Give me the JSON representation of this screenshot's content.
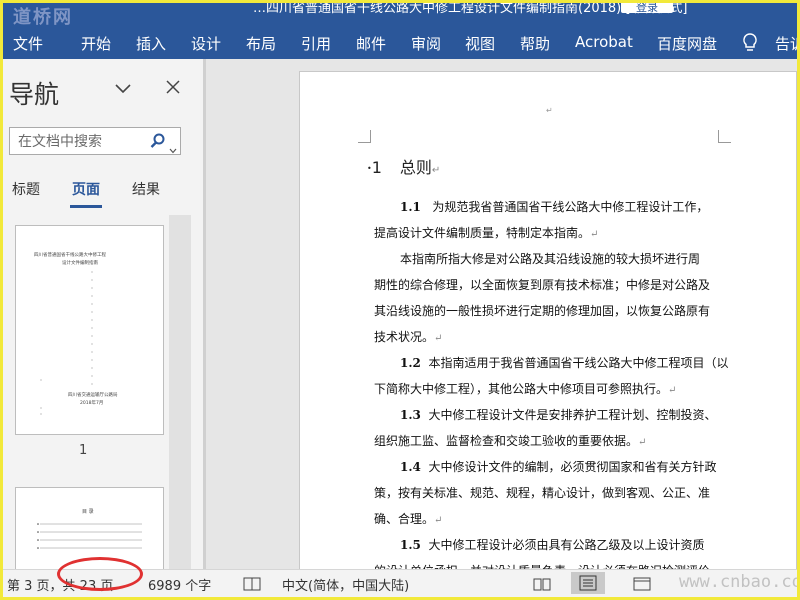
{
  "watermark": "道桥网",
  "title_bar": {
    "title": "…四川省普通国省干线公路大中修工程设计文件编制指南(2018) [兼容模式]",
    "login_label": "登录"
  },
  "ribbon": {
    "tabs": [
      "文件",
      "开始",
      "插入",
      "设计",
      "布局",
      "引用",
      "邮件",
      "审阅",
      "视图",
      "帮助",
      "Acrobat",
      "百度网盘",
      "告诉"
    ],
    "icons": [
      "lightbulb-icon"
    ]
  },
  "navigation": {
    "title": "导航",
    "search_placeholder": "在文档中搜索",
    "tabs": [
      "标题",
      "页面",
      "结果"
    ],
    "active_tab": "页面",
    "thumbnails": [
      {
        "page_number": "1",
        "lines": [
          "四川省普通国省干线公路大中修工程",
          "设计文件编制指南"
        ],
        "footer": [
          "四川省交通运输厅公路局",
          "2018年7月"
        ]
      },
      {
        "page_number": "",
        "lines": [
          "目 录"
        ]
      }
    ]
  },
  "document": {
    "header_mark": "↵",
    "heading": {
      "number": "1",
      "text": "总则"
    },
    "paragraphs": [
      {
        "num": "1.1",
        "lines": [
          "为规范我省普通国省干线公路大中修工程设计工作，",
          "提高设计文件编制质量，特制定本指南。"
        ]
      },
      {
        "num": "",
        "lines": [
          "本指南所指大修是对公路及其沿线设施的较大损坏进行周",
          "期性的综合修理，以全面恢复到原有技术标准；中修是对公路及",
          "其沿线设施的一般性损坏进行定期的修理加固，以恢复公路原有",
          "技术状况。"
        ]
      },
      {
        "num": "1.2",
        "lines": [
          "本指南适用于我省普通国省干线公路大中修工程项目（以",
          "下简称大中修工程），其他公路大中修项目可参照执行。"
        ]
      },
      {
        "num": "1.3",
        "lines": [
          "大中修工程设计文件是安排养护工程计划、控制投资、",
          "组织施工监、监督检查和交竣工验收的重要依据。"
        ]
      },
      {
        "num": "1.4",
        "lines": [
          "大中修设计文件的编制，必须贯彻国家和省有关方针政",
          "策，按有关标准、规范、规程，精心设计，做到客观、公正、准",
          "确、合理。"
        ]
      },
      {
        "num": "1.5",
        "lines": [
          "大中修工程设计必须由具有公路乙级及以上设计资质",
          "的设计单位承担，并对设计质量负责。设计必须在路况检测评价"
        ]
      }
    ],
    "para_mark": "↵"
  },
  "status_bar": {
    "page_info": "第 3 页，共 23 页",
    "word_count": "6989 个字",
    "language": "中文(简体，中国大陆)",
    "watermark": "www.cnbao.com"
  },
  "colors": {
    "accent": "#2b579a",
    "annotation": "#e03131",
    "frame": "#f2e93a"
  }
}
